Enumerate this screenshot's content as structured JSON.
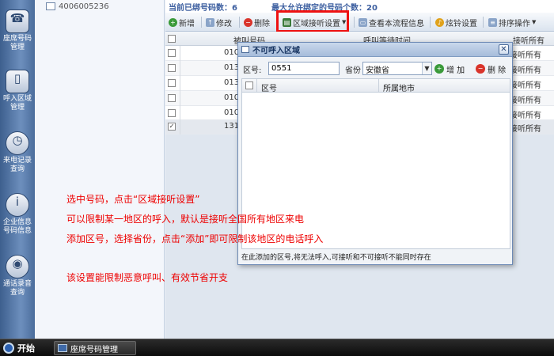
{
  "dock": {
    "items": [
      {
        "label": "座席号码管理",
        "icon": "phone-icon"
      },
      {
        "label": "呼入区域管理",
        "icon": "switch-icon"
      },
      {
        "label": "来电记录查询",
        "icon": "clock-icon"
      },
      {
        "label": "企业信息号码信息",
        "icon": "info-icon"
      },
      {
        "label": "通话录音查询",
        "icon": "recorder-icon"
      }
    ]
  },
  "leftcol": {
    "number": "4006005236"
  },
  "info": {
    "bound": "当前已绑号码数：6",
    "max_allowed": "最大允许绑定的号码个数：20"
  },
  "toolbar": {
    "add": "新增",
    "edit": "修改",
    "delete": "删除",
    "area_setting": "区域接听设置",
    "view_flow": "查看本流程信息",
    "ring_setting": "炫铃设置",
    "sort": "排序操作"
  },
  "grid": {
    "columns": [
      "被叫号码",
      "呼叫等待时间",
      "接听所有"
    ],
    "rows": [
      {
        "num": "010",
        "right": "接听所有",
        "checked": false
      },
      {
        "num": "013",
        "right": "接听所有",
        "checked": false
      },
      {
        "num": "013",
        "right": "接听所有",
        "checked": false
      },
      {
        "num": "010",
        "right": "接听所有",
        "checked": false
      },
      {
        "num": "010",
        "right": "接听所有",
        "checked": false
      },
      {
        "num": "131",
        "right": "接听所有",
        "checked": true
      }
    ]
  },
  "dialog": {
    "title": "不可呼入区域",
    "area_label": "区号:",
    "area_value": "0551",
    "province_label": "省份",
    "province_value": "安徽省",
    "add": "增 加",
    "delete": "删 除",
    "col_area": "区号",
    "col_city": "所属地市",
    "footer": "在此添加的区号,将无法呼入,可接听和不可接听不能同时存在"
  },
  "notes": [
    "选中号码，点击“区域接听设置”",
    "可以限制某一地区的呼入，默认是接听全国所有地区来电",
    "添加区号，选择省份，点击“添加”即可限制该地区的电话呼入",
    "该设置能限制恶意呼叫、有效节省开支"
  ],
  "taskbar": {
    "start": "开始",
    "task": "座席号码管理"
  },
  "colors": {
    "annotation": "#ee0000",
    "highlight": "#ee1111",
    "dock": "#4b6d9c"
  }
}
